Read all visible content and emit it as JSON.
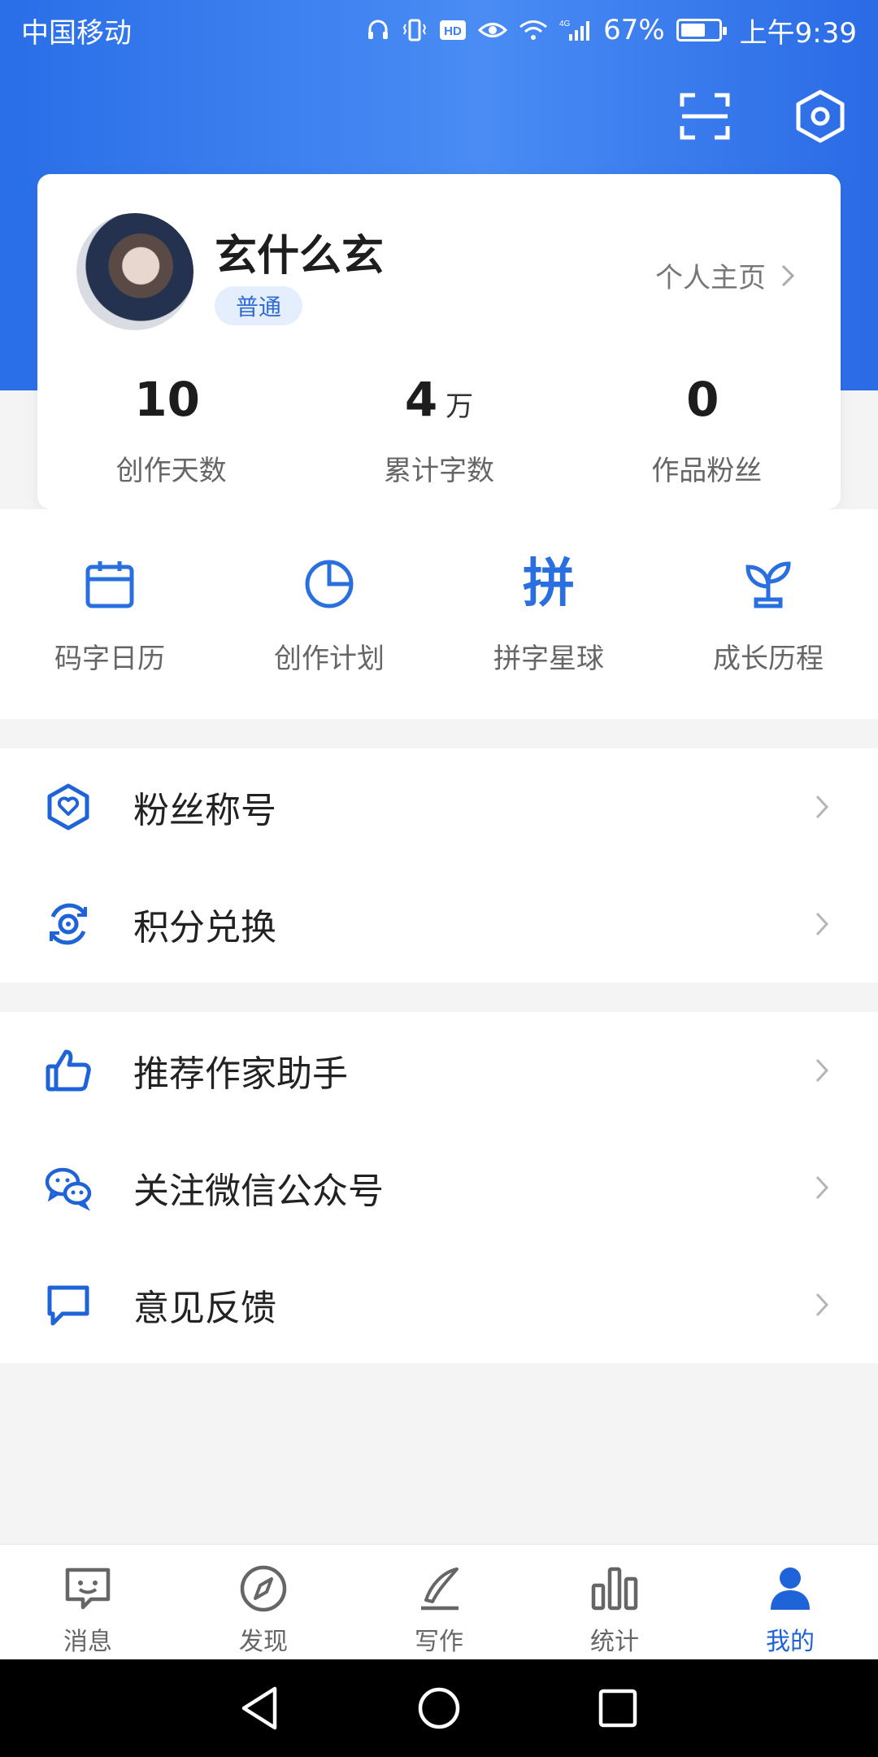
{
  "status_bar": {
    "carrier": "中国移动",
    "battery": "67%",
    "battery_level": 0.67,
    "time": "上午9:39",
    "hd_label": "HD",
    "network_label": "4G"
  },
  "top_actions": {
    "scan_icon": "scan-icon",
    "settings_icon": "settings-icon"
  },
  "profile": {
    "name": "玄什么玄",
    "level": "普通",
    "homepage_label": "个人主页"
  },
  "stats": [
    {
      "value": "10",
      "unit": "",
      "label": "创作天数"
    },
    {
      "value": "4",
      "unit": "万",
      "label": "累计字数"
    },
    {
      "value": "0",
      "unit": "",
      "label": "作品粉丝"
    }
  ],
  "tools": [
    {
      "label": "码字日历",
      "icon": "calendar-icon"
    },
    {
      "label": "创作计划",
      "icon": "pie-chart-icon"
    },
    {
      "label": "拼字星球",
      "icon": "pin-character-icon",
      "glyph": "拼"
    },
    {
      "label": "成长历程",
      "icon": "sprout-icon"
    }
  ],
  "menu_group_1": [
    {
      "label": "粉丝称号",
      "icon": "badge-heart-icon"
    },
    {
      "label": "积分兑换",
      "icon": "points-exchange-icon"
    }
  ],
  "menu_group_2": [
    {
      "label": "推荐作家助手",
      "icon": "thumbs-up-icon"
    },
    {
      "label": "关注微信公众号",
      "icon": "wechat-icon"
    },
    {
      "label": "意见反馈",
      "icon": "feedback-icon"
    }
  ],
  "bottom_nav": [
    {
      "label": "消息",
      "icon": "message-icon",
      "active": false
    },
    {
      "label": "发现",
      "icon": "compass-icon",
      "active": false
    },
    {
      "label": "写作",
      "icon": "pen-icon",
      "active": false
    },
    {
      "label": "统计",
      "icon": "bar-chart-icon",
      "active": false
    },
    {
      "label": "我的",
      "icon": "person-icon",
      "active": true
    }
  ],
  "colors": {
    "accent": "#1f63d8",
    "header_start": "#2a6ee8",
    "header_mid": "#4a8cf4"
  }
}
